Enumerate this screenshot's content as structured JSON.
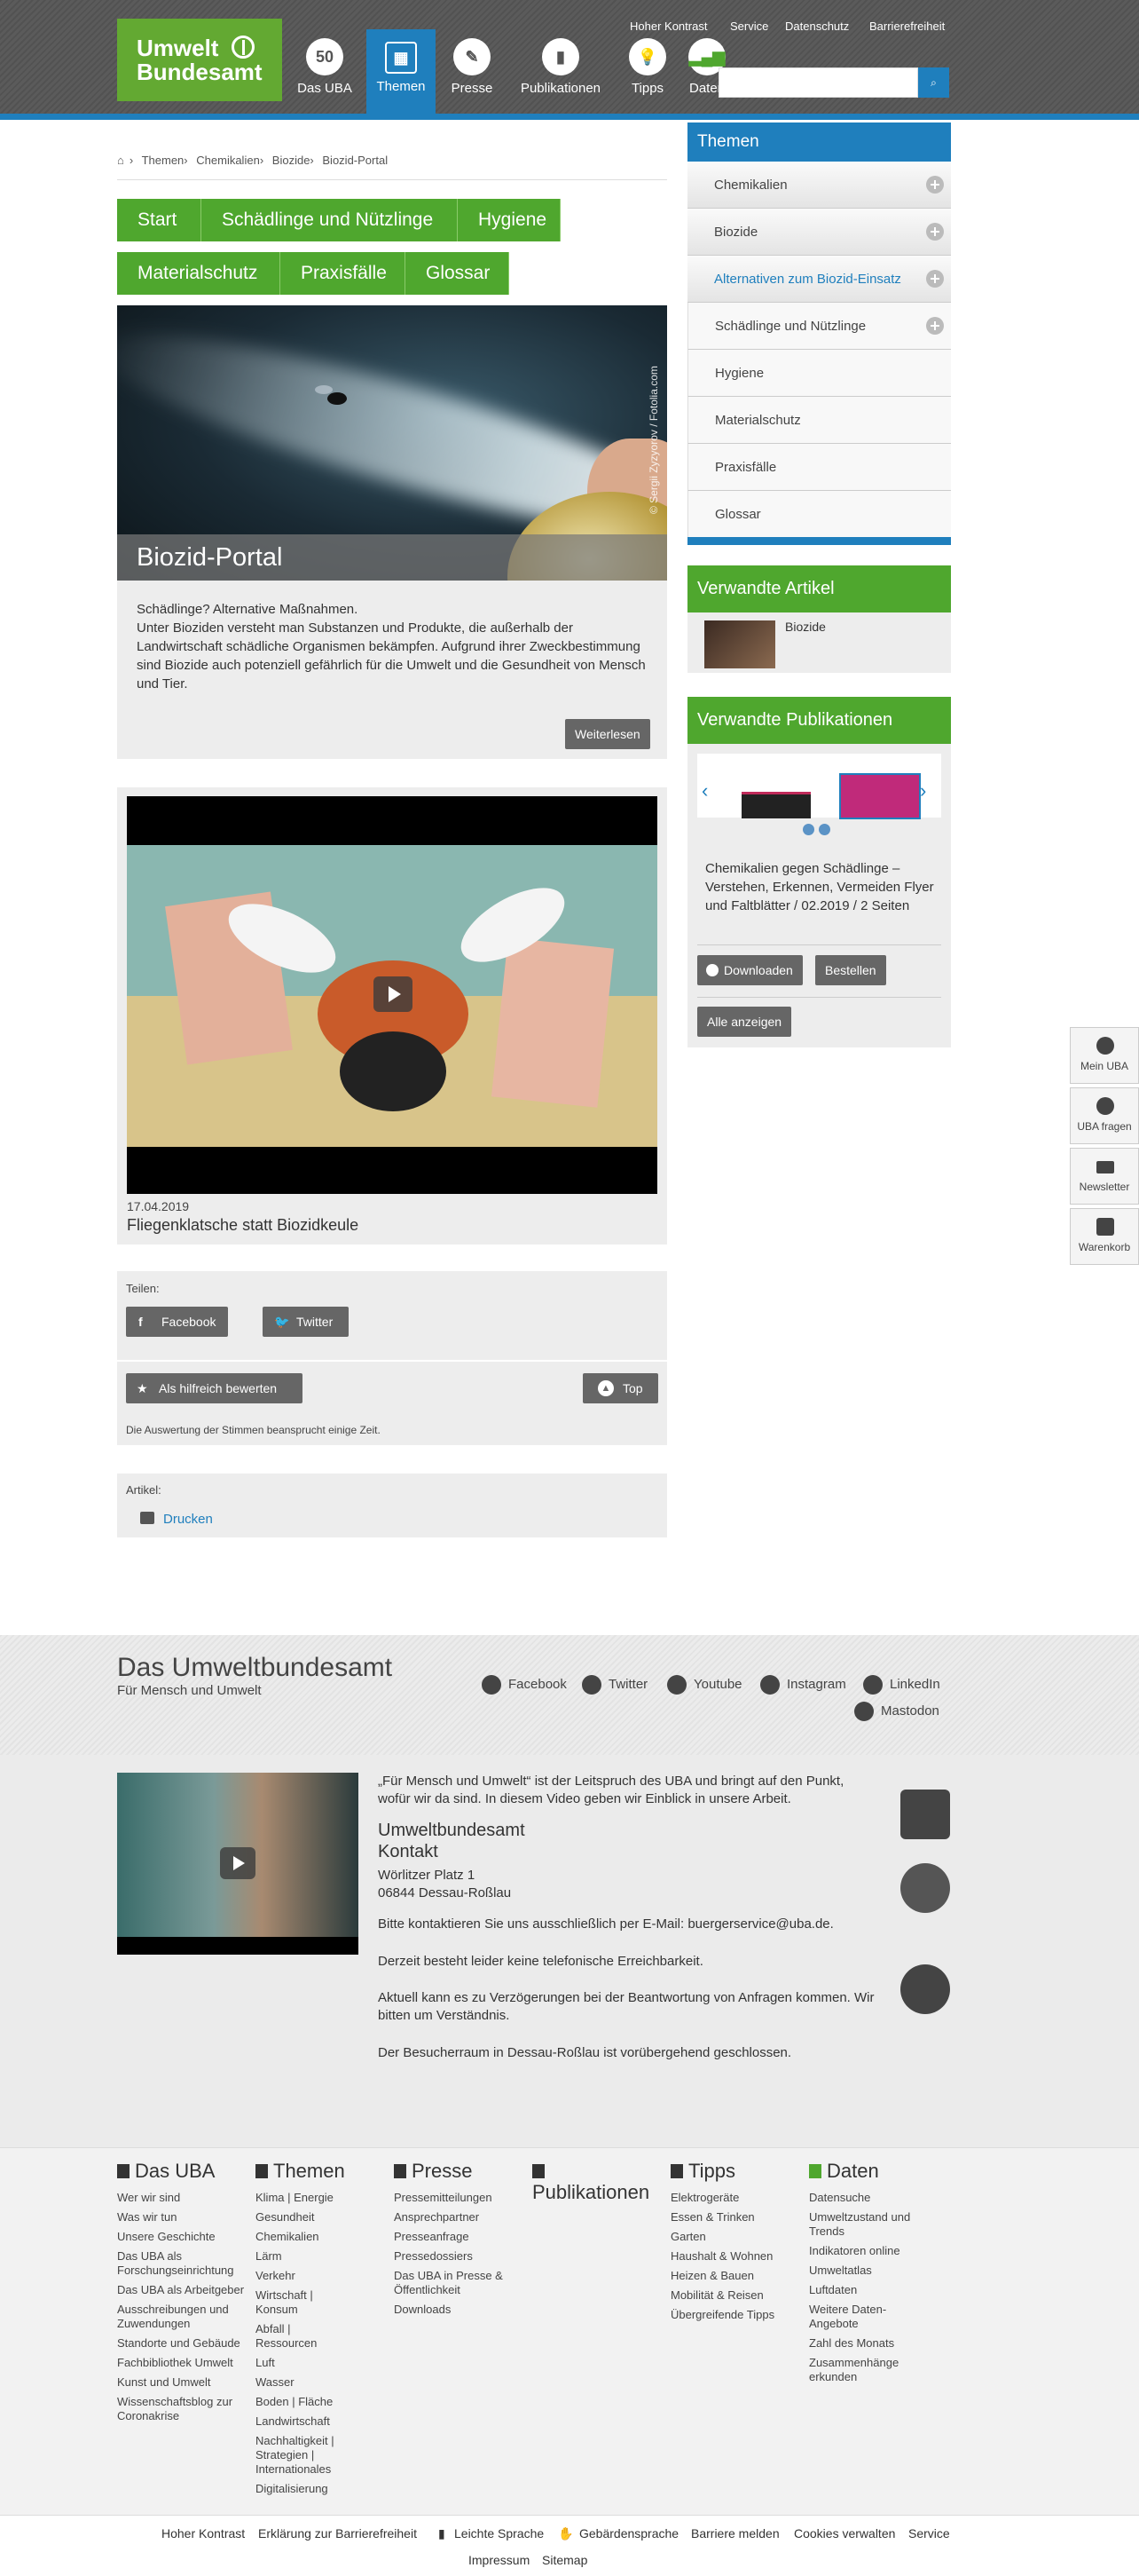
{
  "logo": {
    "line1": "Umwelt",
    "line2": "Bundesamt"
  },
  "meta_links": [
    "Hoher Kontrast",
    "Service",
    "Datenschutz",
    "Barrierefreiheit"
  ],
  "nav": [
    {
      "label": "Das UBA",
      "icon": "uba-50-icon"
    },
    {
      "label": "Themen",
      "icon": "grid-icon"
    },
    {
      "label": "Presse",
      "icon": "newspaper-icon"
    },
    {
      "label": "Publikationen",
      "icon": "book-icon"
    },
    {
      "label": "Tipps",
      "icon": "lightbulb-icon"
    },
    {
      "label": "Daten",
      "icon": "bar-chart-icon"
    }
  ],
  "search": {
    "placeholder": "",
    "button": "search-icon"
  },
  "breadcrumb": [
    "Themen",
    "Chemikalien",
    "Biozide",
    "Biozid-Portal"
  ],
  "tabs_row1": [
    "Start",
    "Schädlinge und Nützlinge",
    "Hygiene"
  ],
  "tabs_row2": [
    "Materialschutz",
    "Praxisfälle",
    "Glossar"
  ],
  "hero": {
    "title": "Biozid-Portal",
    "credit": "© Sergii Zyzyorov / Fotolia.com"
  },
  "teaser": {
    "line1": "Schädlinge? Alternative Maßnahmen.",
    "body": "Unter Bioziden versteht man Substanzen und Produkte, die außerhalb der Landwirtschaft schädliche Organismen bekämpfen. Aufgrund ihrer Zweckbestimmung sind Biozide auch potenziell gefährlich für die Umwelt und die Gesundheit von Mensch und Tier.",
    "more": "Weiterlesen"
  },
  "video": {
    "date": "17.04.2019",
    "title": "Fliegenklatsche statt Biozidkeule"
  },
  "share": {
    "label": "Teilen:",
    "facebook": "Facebook",
    "twitter": "Twitter",
    "rate": "Als hilfreich bewerten",
    "top": "Top",
    "note": "Die Auswertung der Stimmen beansprucht einige Zeit."
  },
  "article": {
    "label": "Artikel:",
    "print": "Drucken"
  },
  "sidebar": {
    "title": "Themen",
    "items": [
      "Chemikalien",
      "Biozide",
      "Alternativen zum Biozid-Einsatz",
      "Schädlinge und Nützlinge",
      "Hygiene",
      "Materialschutz",
      "Praxisfälle",
      "Glossar"
    ]
  },
  "related": {
    "title": "Verwandte Artikel",
    "item": "Biozide"
  },
  "publications": {
    "title": "Verwandte Publikationen",
    "desc": "Chemikalien gegen Schädlinge – Verstehen, Erkennen, Vermeiden Flyer und Faltblätter / 02.2019 / 2 Seiten",
    "download": "Downloaden",
    "order": "Bestellen",
    "all": "Alle anzeigen"
  },
  "floating": [
    "Mein UBA",
    "UBA fragen",
    "Newsletter",
    "Warenkorb"
  ],
  "footer": {
    "title": "Das Umweltbundesamt",
    "subtitle": "Für Mensch und Umwelt",
    "social": [
      "Facebook",
      "Twitter",
      "Youtube",
      "Instagram",
      "LinkedIn",
      "Mastodon"
    ],
    "intro": "„Für Mensch und Umwelt“ ist der Leitspruch des UBA und bringt auf den Punkt, wofür wir da sind. In diesem Video geben wir Einblick in unsere Arbeit.",
    "org": "Umweltbundesamt",
    "contact": "Kontakt",
    "street": "Wörlitzer Platz 1",
    "city": "06844 Dessau-Roßlau",
    "email": "Bitte kontaktieren Sie uns ausschließlich per E-Mail: buergerservice@uba.de.",
    "phone": "Derzeit besteht leider keine telefonische Erreichbarkeit.",
    "delay": "Aktuell kann es zu Verzögerungen bei der Beantwortung von Anfragen kommen. Wir bitten um Verständnis.",
    "visitor": "Der Besucherraum in Dessau-Roßlau ist vorübergehend geschlossen."
  },
  "footer_cols": [
    {
      "title": "Das UBA",
      "links": [
        "Wer wir sind",
        "Was wir tun",
        "Unsere Geschichte",
        "Das UBA als Forschungseinrichtung",
        "Das UBA als Arbeitgeber",
        "Ausschreibungen und Zuwendungen",
        "Standorte und Gebäude",
        "Fachbibliothek Umwelt",
        "Kunst und Umwelt",
        "Wissenschaftsblog zur Coronakrise"
      ]
    },
    {
      "title": "Themen",
      "links": [
        "Klima | Energie",
        "Gesundheit",
        "Chemikalien",
        "Lärm",
        "Verkehr",
        "Wirtschaft | Konsum",
        "Abfall | Ressourcen",
        "Luft",
        "Wasser",
        "Boden | Fläche",
        "Landwirtschaft",
        "Nachhaltigkeit | Strategien | Internationales",
        "Digitalisierung"
      ]
    },
    {
      "title": "Presse",
      "links": [
        "Pressemitteilungen",
        "Ansprechpartner",
        "Presseanfrage",
        "Pressedossiers",
        "Das UBA in Presse & Öffentlichkeit",
        "Downloads"
      ]
    },
    {
      "title": "Publikationen",
      "links": []
    },
    {
      "title": "Tipps",
      "links": [
        "Elektrogeräte",
        "Essen & Trinken",
        "Garten",
        "Haushalt & Wohnen",
        "Heizen & Bauen",
        "Mobilität & Reisen",
        "Übergreifende Tipps"
      ]
    },
    {
      "title": "Daten",
      "links": [
        "Datensuche",
        "Umweltzustand und Trends",
        "Indikatoren online",
        "Umweltatlas",
        "Luftdaten",
        "Weitere Daten-Angebote",
        "Zahl des Monats",
        "Zusammenhänge erkunden"
      ]
    }
  ],
  "bottom_links": [
    "Hoher Kontrast",
    "Erklärung zur Barrierefreiheit",
    "Leichte Sprache",
    "Gebärdensprache",
    "Barriere melden",
    "Cookies verwalten",
    "Service",
    "Impressum",
    "Sitemap"
  ]
}
